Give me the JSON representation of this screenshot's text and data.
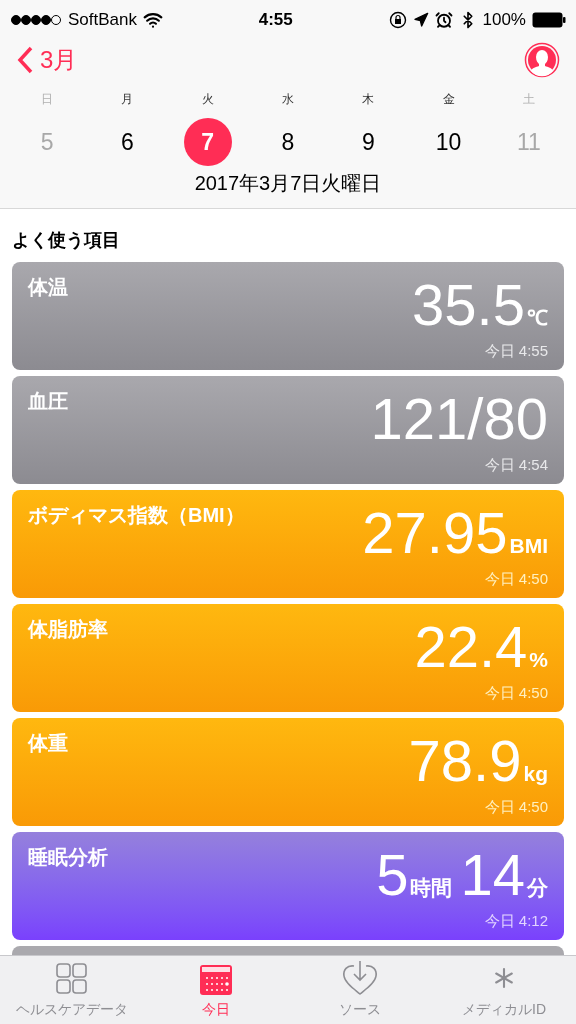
{
  "status_bar": {
    "carrier": "SoftBank",
    "time": "4:55",
    "battery": "100%"
  },
  "nav": {
    "back": "3月"
  },
  "week": [
    {
      "weekday": "日",
      "date": "5",
      "selected": false,
      "dimmed": true
    },
    {
      "weekday": "月",
      "date": "6",
      "selected": false,
      "dimmed": false
    },
    {
      "weekday": "火",
      "date": "7",
      "selected": true,
      "dimmed": false
    },
    {
      "weekday": "水",
      "date": "8",
      "selected": false,
      "dimmed": false
    },
    {
      "weekday": "木",
      "date": "9",
      "selected": false,
      "dimmed": false
    },
    {
      "weekday": "金",
      "date": "10",
      "selected": false,
      "dimmed": false
    },
    {
      "weekday": "土",
      "date": "11",
      "selected": false,
      "dimmed": true
    }
  ],
  "selected_date": "2017年3月7日火曜日",
  "section_title": "よく使う項目",
  "cards": [
    {
      "title": "体温",
      "kind": "gray",
      "value": [
        {
          "text": "35.5",
          "kind": "number"
        },
        {
          "text": "℃",
          "kind": "unit"
        }
      ],
      "time": "今日 4:55"
    },
    {
      "title": "血圧",
      "kind": "gray",
      "value": [
        {
          "text": "121/80",
          "kind": "number"
        }
      ],
      "time": "今日 4:54"
    },
    {
      "title": "ボディマス指数（BMI）",
      "kind": "orange",
      "value": [
        {
          "text": "27.95",
          "kind": "number"
        },
        {
          "text": "BMI",
          "kind": "unit"
        }
      ],
      "time": "今日 4:50"
    },
    {
      "title": "体脂肪率",
      "kind": "orange",
      "value": [
        {
          "text": "22.4",
          "kind": "number"
        },
        {
          "text": "%",
          "kind": "unit"
        }
      ],
      "time": "今日 4:50"
    },
    {
      "title": "体重",
      "kind": "orange",
      "value": [
        {
          "text": "78.9",
          "kind": "number"
        },
        {
          "text": "kg",
          "kind": "unit"
        }
      ],
      "time": "今日 4:50"
    },
    {
      "title": "睡眠分析",
      "kind": "purple",
      "value": [
        {
          "text": "5",
          "kind": "number"
        },
        {
          "text": "時間",
          "kind": "unit"
        },
        {
          "text": "14",
          "kind": "number"
        },
        {
          "text": "分",
          "kind": "unit"
        }
      ],
      "time": "今日 4:12"
    }
  ],
  "tabs": [
    {
      "label": "ヘルスケアデータ",
      "kind": "grid",
      "selected": false
    },
    {
      "label": "今日",
      "kind": "calendar",
      "selected": true
    },
    {
      "label": "ソース",
      "kind": "heart",
      "selected": false
    },
    {
      "label": "メディカルID",
      "kind": "asterisk",
      "selected": false
    }
  ]
}
